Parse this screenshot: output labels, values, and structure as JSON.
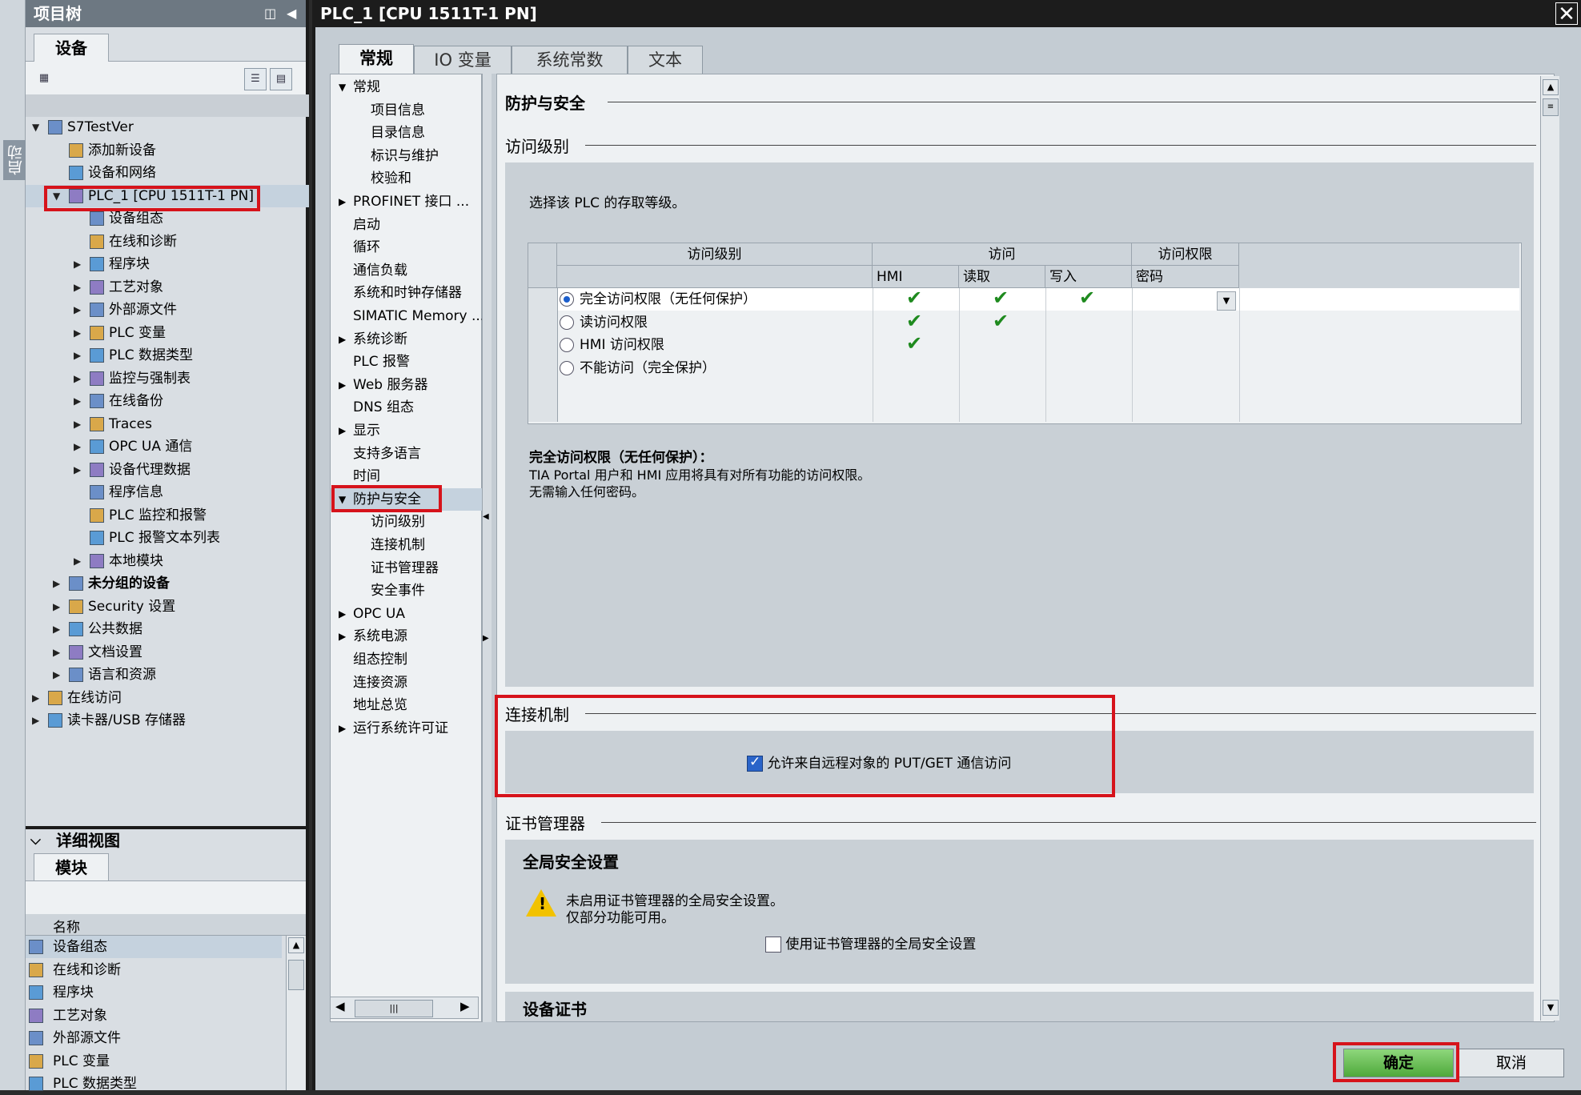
{
  "side_strip": {
    "label": "启动"
  },
  "project_tree": {
    "title": "项目树",
    "tab": "设备",
    "items": [
      {
        "label": "S7TestVer",
        "level": 0,
        "expanded": true
      },
      {
        "label": "添加新设备",
        "level": 1
      },
      {
        "label": "设备和网络",
        "level": 1
      },
      {
        "label": "PLC_1 [CPU 1511T-1 PN]",
        "level": 1,
        "expanded": true,
        "highlight": true
      },
      {
        "label": "设备组态",
        "level": 2
      },
      {
        "label": "在线和诊断",
        "level": 2
      },
      {
        "label": "程序块",
        "level": 2,
        "collapsed": true
      },
      {
        "label": "工艺对象",
        "level": 2,
        "collapsed": true
      },
      {
        "label": "外部源文件",
        "level": 2,
        "collapsed": true
      },
      {
        "label": "PLC 变量",
        "level": 2,
        "collapsed": true
      },
      {
        "label": "PLC 数据类型",
        "level": 2,
        "collapsed": true
      },
      {
        "label": "监控与强制表",
        "level": 2,
        "collapsed": true
      },
      {
        "label": "在线备份",
        "level": 2,
        "collapsed": true
      },
      {
        "label": "Traces",
        "level": 2,
        "collapsed": true
      },
      {
        "label": "OPC UA 通信",
        "level": 2,
        "collapsed": true
      },
      {
        "label": "设备代理数据",
        "level": 2,
        "collapsed": true
      },
      {
        "label": "程序信息",
        "level": 2
      },
      {
        "label": "PLC 监控和报警",
        "level": 2
      },
      {
        "label": "PLC 报警文本列表",
        "level": 2
      },
      {
        "label": "本地模块",
        "level": 2,
        "collapsed": true
      },
      {
        "label": "未分组的设备",
        "level": 1,
        "collapsed": true,
        "bold": true
      },
      {
        "label": "Security 设置",
        "level": 1,
        "collapsed": true
      },
      {
        "label": "公共数据",
        "level": 1,
        "collapsed": true
      },
      {
        "label": "文档设置",
        "level": 1,
        "collapsed": true
      },
      {
        "label": "语言和资源",
        "level": 1,
        "collapsed": true
      },
      {
        "label": "在线访问",
        "level": 0,
        "collapsed": true
      },
      {
        "label": "读卡器/USB 存储器",
        "level": 0,
        "collapsed": true
      }
    ]
  },
  "detail_view": {
    "title": "详细视图",
    "tab": "模块",
    "column": "名称",
    "items": [
      "设备组态",
      "在线和诊断",
      "程序块",
      "工艺对象",
      "外部源文件",
      "PLC 变量",
      "PLC 数据类型"
    ]
  },
  "dialog": {
    "title": "PLC_1 [CPU 1511T-1 PN]",
    "close": "✕",
    "tabs": [
      "常规",
      "IO 变量",
      "系统常数",
      "文本"
    ],
    "nav": [
      {
        "label": "常规",
        "level": 0,
        "expanded": true
      },
      {
        "label": "项目信息",
        "level": 1
      },
      {
        "label": "目录信息",
        "level": 1
      },
      {
        "label": "标识与维护",
        "level": 1
      },
      {
        "label": "校验和",
        "level": 1
      },
      {
        "label": "PROFINET 接口 ...",
        "level": 0,
        "collapsed": true
      },
      {
        "label": "启动",
        "level": 0
      },
      {
        "label": "循环",
        "level": 0
      },
      {
        "label": "通信负载",
        "level": 0
      },
      {
        "label": "系统和时钟存储器",
        "level": 0
      },
      {
        "label": "SIMATIC Memory ...",
        "level": 0
      },
      {
        "label": "系统诊断",
        "level": 0,
        "collapsed": true
      },
      {
        "label": "PLC 报警",
        "level": 0
      },
      {
        "label": "Web 服务器",
        "level": 0,
        "collapsed": true
      },
      {
        "label": "DNS 组态",
        "level": 0
      },
      {
        "label": "显示",
        "level": 0,
        "collapsed": true
      },
      {
        "label": "支持多语言",
        "level": 0
      },
      {
        "label": "时间",
        "level": 0
      },
      {
        "label": "防护与安全",
        "level": 0,
        "expanded": true,
        "selected": true
      },
      {
        "label": "访问级别",
        "level": 1
      },
      {
        "label": "连接机制",
        "level": 1
      },
      {
        "label": "证书管理器",
        "level": 1
      },
      {
        "label": "安全事件",
        "level": 1
      },
      {
        "label": "OPC UA",
        "level": 0,
        "collapsed": true
      },
      {
        "label": "系统电源",
        "level": 0,
        "collapsed": true
      },
      {
        "label": "组态控制",
        "level": 0
      },
      {
        "label": "连接资源",
        "level": 0
      },
      {
        "label": "地址总览",
        "level": 0
      },
      {
        "label": "运行系统许可证",
        "level": 0,
        "collapsed": true
      }
    ],
    "content": {
      "section_title": "防护与安全",
      "access_level": {
        "title": "访问级别",
        "prompt": "选择该 PLC 的存取等级。",
        "headers": {
          "level": "访问级别",
          "access": "访问",
          "permission": "访问权限",
          "hmi": "HMI",
          "read": "读取",
          "write": "写入",
          "password": "密码"
        },
        "rows": [
          {
            "label": "完全访问权限（无任何保护）",
            "selected": true,
            "hmi": true,
            "read": true,
            "write": true
          },
          {
            "label": "读访问权限",
            "selected": false,
            "hmi": true,
            "read": true,
            "write": false
          },
          {
            "label": "HMI 访问权限",
            "selected": false,
            "hmi": true,
            "read": false,
            "write": false
          },
          {
            "label": "不能访问（完全保护）",
            "selected": false,
            "hmi": false,
            "read": false,
            "write": false
          }
        ],
        "desc_title": "完全访问权限（无任何保护）：",
        "desc_line1": "TIA Portal 用户和 HMI 应用将具有对所有功能的访问权限。",
        "desc_line2": "无需输入任何密码。"
      },
      "connection": {
        "title": "连接机制",
        "checkbox_label": "允许来自远程对象的 PUT/GET 通信访问",
        "checked": true
      },
      "cert_manager": {
        "title": "证书管理器",
        "sub_title": "全局安全设置",
        "warning_line1": "未启用证书管理器的全局安全设置。",
        "warning_line2": "仅部分功能可用。",
        "checkbox_label": "使用证书管理器的全局安全设置",
        "checked": false,
        "next_title": "设备证书"
      }
    },
    "buttons": {
      "ok": "确定",
      "cancel": "取消"
    }
  },
  "colors": {
    "highlight_red": "#d6131b",
    "ok_green": "#5fbf4c",
    "check_green": "#1e8a1e"
  }
}
